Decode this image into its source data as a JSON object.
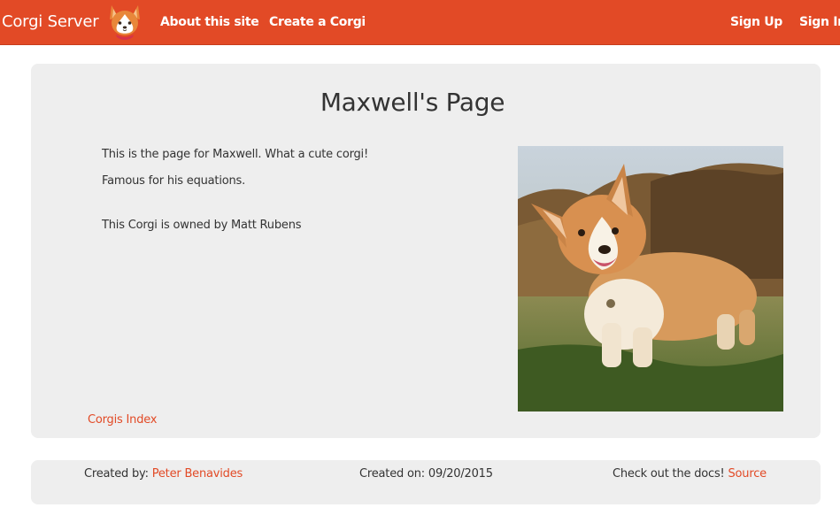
{
  "navbar": {
    "brand": "Corgi Server",
    "logo_icon": "corgi-logo-icon",
    "links": [
      {
        "label": "About this site"
      },
      {
        "label": "Create a Corgi"
      }
    ],
    "right_links": [
      {
        "label": "Sign Up"
      },
      {
        "label": "Sign In"
      }
    ],
    "color": "#e24a26"
  },
  "main": {
    "title": "Maxwell's Page",
    "intro": "This is the page for Maxwell. What a cute corgi!",
    "description": "Famous for his equations.",
    "owner": "This Corgi is owned by Matt Rubens",
    "photo_icon": "corgi-photo",
    "index_link": "Corgis Index"
  },
  "footer": {
    "created_by_label": "Created by: ",
    "created_by_name": "Peter Benavides",
    "created_on": "Created on: 09/20/2015",
    "docs_label": "Check out the docs! ",
    "docs_link": "Source"
  },
  "colors": {
    "accent": "#e24a26",
    "card_bg": "#eeeeee"
  }
}
